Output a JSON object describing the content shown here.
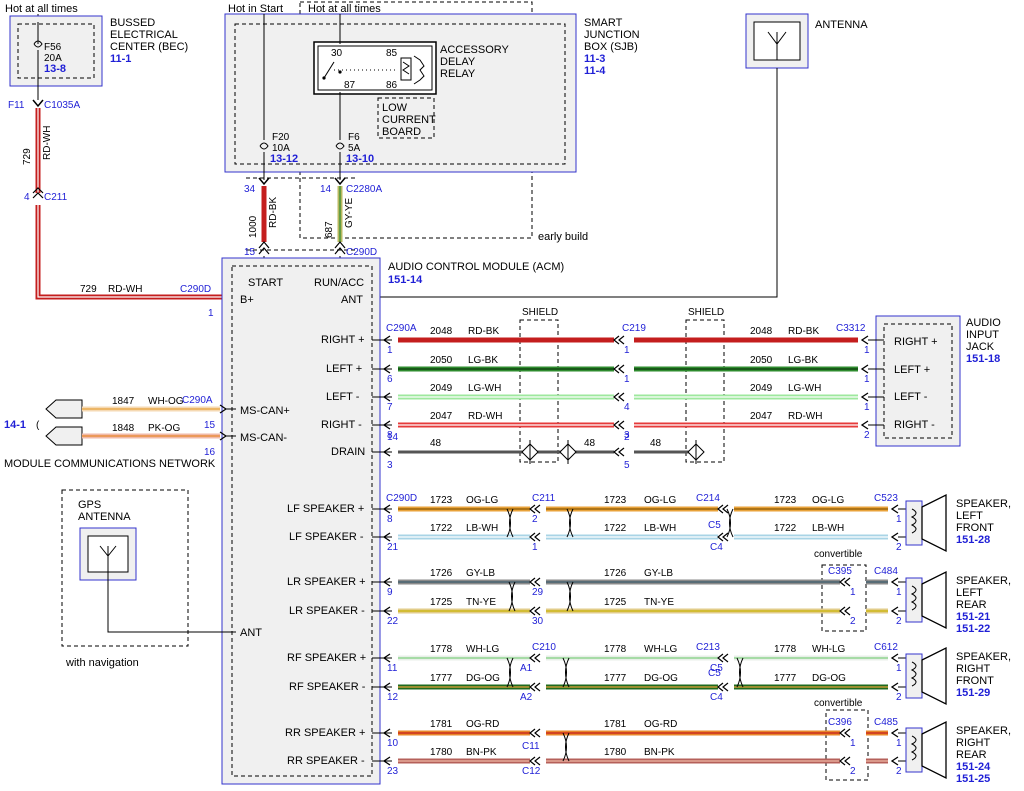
{
  "top": {
    "hot_all_left": "Hot at all times",
    "hot_start": "Hot in Start",
    "hot_all_mid": "Hot at all times",
    "early_build": "early build",
    "with_navigation": "with navigation",
    "convertible1": "convertible",
    "convertible2": "convertible"
  },
  "bec": {
    "l1": "BUSSED",
    "l2": "ELECTRICAL",
    "l3": "CENTER (BEC)",
    "ref": "11-1",
    "fuse": "F56",
    "amp": "20A",
    "fref": "13-8",
    "fid": "F11",
    "conn": "C1035A"
  },
  "sjb": {
    "l1": "SMART",
    "l2": "JUNCTION",
    "l3": "BOX (SJB)",
    "ref1": "11-3",
    "ref2": "11-4",
    "relay1": "ACCESSORY",
    "relay2": "DELAY",
    "relay3": "RELAY",
    "p30": "30",
    "p85": "85",
    "p87": "87",
    "p86": "86",
    "lc1": "LOW",
    "lc2": "CURRENT",
    "lc3": "BOARD",
    "f20": "F20",
    "f20a": "10A",
    "f20ref": "13-12",
    "f6": "F6",
    "f6a": "5A",
    "f6ref": "13-10"
  },
  "antenna": {
    "label": "ANTENNA"
  },
  "acm": {
    "title": "AUDIO CONTROL MODULE (ACM)",
    "ref": "151-14",
    "start": "START",
    "runacc": "RUN/ACC",
    "bplus": "B+",
    "ant": "ANT",
    "right_plus": "RIGHT +",
    "left_plus": "LEFT +",
    "left_minus": "LEFT -",
    "right_minus": "RIGHT -",
    "drain": "DRAIN",
    "mscan_plus": "MS-CAN+",
    "mscan_minus": "MS-CAN-",
    "lf_plus": "LF SPEAKER +",
    "lf_minus": "LF SPEAKER -",
    "lr_plus": "LR SPEAKER +",
    "lr_minus": "LR SPEAKER -",
    "rf_plus": "RF SPEAKER +",
    "rf_minus": "RF SPEAKER -",
    "rr_plus": "RR SPEAKER +",
    "rr_minus": "RR SPEAKER -",
    "ant2": "ANT"
  },
  "jack": {
    "l1": "AUDIO",
    "l2": "INPUT",
    "l3": "JACK",
    "ref": "151-18",
    "rp": "RIGHT +",
    "lp": "LEFT +",
    "lm": "LEFT -",
    "rm": "RIGHT -"
  },
  "gps": {
    "l1": "GPS",
    "l2": "ANTENNA"
  },
  "mcn": {
    "label": "MODULE COMMUNICATIONS NETWORK",
    "ref": "14-1"
  },
  "wires": {
    "w729": "729",
    "rdwh": "RD-WH",
    "w1000": "1000",
    "rdbk": "RD-BK",
    "w687": "687",
    "gyye": "GY-YE",
    "w2048": "2048",
    "w2050": "2050",
    "lgbk": "LG-BK",
    "w2049": "2049",
    "lgwh": "LG-WH",
    "w2047": "2047",
    "w48": "48",
    "shield": "SHIELD",
    "w1847": "1847",
    "whog": "WH-OG",
    "w1848": "1848",
    "pkog": "PK-OG",
    "w1723": "1723",
    "oglg": "OG-LG",
    "w1722": "1722",
    "lbwh": "LB-WH",
    "w1726": "1726",
    "gylb": "GY-LB",
    "w1725": "1725",
    "tnye": "TN-YE",
    "w1778": "1778",
    "whlg": "WH-LG",
    "w1777": "1777",
    "dgog": "DG-OG",
    "w1781": "1781",
    "ogrd": "OG-RD",
    "w1780": "1780",
    "bnpk": "BN-PK"
  },
  "connectors": {
    "c211": "C211",
    "c2280a": "C2280A",
    "c290d": "C290D",
    "c290a": "C290A",
    "c219": "C219",
    "c3312": "C3312",
    "c214": "C214",
    "c523": "C523",
    "c395": "C395",
    "c484": "C484",
    "c210": "C210",
    "c213": "C213",
    "c612": "C612",
    "c396": "C396",
    "c485": "C485",
    "c5": "C5",
    "c4": "C4",
    "c11": "C11",
    "c12": "C12",
    "a1": "A1",
    "a2": "A2"
  },
  "pins": {
    "p1": "1",
    "p2": "2",
    "p3": "3",
    "p4": "4",
    "p5": "5",
    "p6": "6",
    "p7": "7",
    "p8": "8",
    "p9": "9",
    "p10": "10",
    "p11": "11",
    "p12": "12",
    "p14": "14",
    "p15": "15",
    "p16": "16",
    "p21": "21",
    "p22": "22",
    "p23": "23",
    "p29": "29",
    "p30": "30",
    "p34": "34"
  },
  "speakers": {
    "lf": [
      "SPEAKER,",
      "LEFT",
      "FRONT"
    ],
    "lf_ref": "151-28",
    "lr": [
      "SPEAKER,",
      "LEFT",
      "REAR"
    ],
    "lr_ref1": "151-21",
    "lr_ref2": "151-22",
    "rf": [
      "SPEAKER,",
      "RIGHT",
      "FRONT"
    ],
    "rf_ref": "151-29",
    "rr": [
      "SPEAKER,",
      "RIGHT",
      "REAR"
    ],
    "rr_ref1": "151-24",
    "rr_ref2": "151-25"
  },
  "colors": {
    "red": "#c41e1e",
    "lgbk": "#2e8b2e",
    "lgwh": "#9ee89e",
    "rdwh": "#e63a3a",
    "gray": "#555555",
    "og": "#e8a23a",
    "lb": "#a9d4e6",
    "gy": "#8a8a8a",
    "tn": "#e2cc8a",
    "wh": "#e8efe8",
    "dg": "#1f6b1f",
    "ogrd": "#e8862a",
    "bnpk": "#b5605a",
    "whog": "#f5d9b3",
    "pkog": "#f0b9a8",
    "gyye": "#b8b860",
    "blue": "#1f1fd6"
  }
}
